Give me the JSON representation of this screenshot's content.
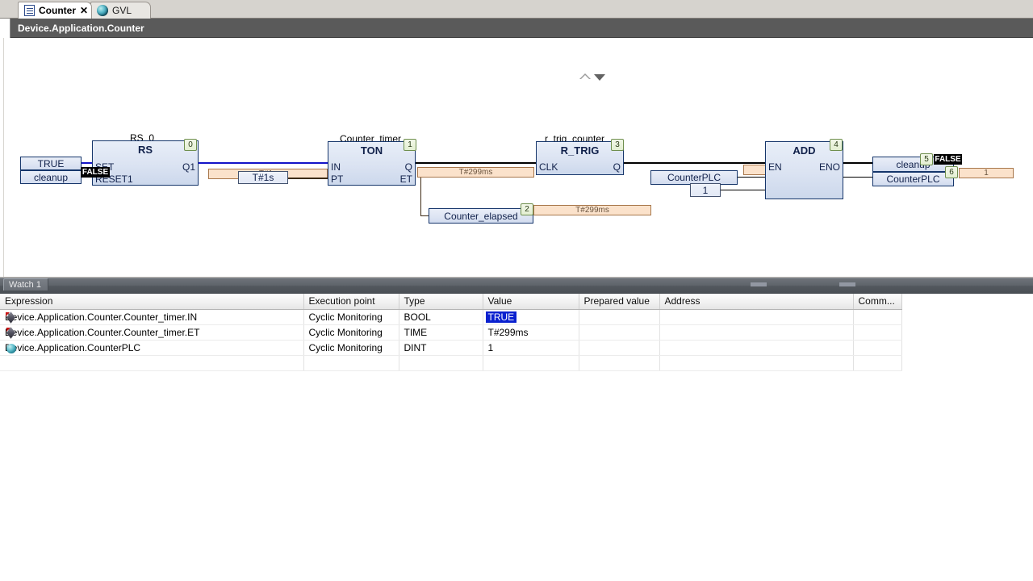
{
  "window": {
    "path_title": "Device.Application.Counter"
  },
  "tabs": [
    {
      "label": "Counter",
      "icon": "document-icon",
      "active": true,
      "close_label": "✕"
    },
    {
      "label": "GVL",
      "icon": "globe-icon",
      "active": false
    }
  ],
  "editor": {
    "nav_up": "scroll-up-arrow",
    "nav_down": "scroll-down-arrow",
    "blocks": [
      {
        "instance": "RS_0",
        "type": "RS",
        "badge": "0",
        "inputs": [
          "SET",
          "RESET1"
        ],
        "outputs": [
          "Q1"
        ]
      },
      {
        "instance": "Counter_timer",
        "type": "TON",
        "badge": "1",
        "inputs": [
          "IN",
          "PT"
        ],
        "outputs": [
          "Q",
          "ET"
        ]
      },
      {
        "instance": "r_trig_counter",
        "type": "R_TRIG",
        "badge": "3",
        "inputs": [
          "CLK"
        ],
        "outputs": [
          "Q"
        ]
      },
      {
        "instance": "",
        "type": "ADD",
        "badge": "4",
        "inputs": [
          "EN"
        ],
        "outputs": [
          "ENO"
        ]
      }
    ],
    "variables": {
      "rs_set_input": "TRUE",
      "rs_reset_input": "cleanup",
      "ton_pt_const": "T#1s",
      "counter_elapsed": "Counter_elapsed",
      "add_in_var": "CounterPLC",
      "add_in_const": "1",
      "out_cleanup": "cleanup",
      "out_counterplc": "CounterPLC"
    },
    "monitor_values": {
      "rs_reset_tooltip": "FALSE",
      "ton_pt_value": "T#1s",
      "ton_et_value": "T#299ms",
      "counter_elapsed_value": "T#299ms",
      "add_en_value": "1",
      "out_cleanup_value": "FALSE",
      "out_counterplc_value": "1"
    },
    "badges": {
      "counter_elapsed": "2",
      "out_cleanup": "5",
      "out_counterplc": "6"
    }
  },
  "watch": {
    "panel_title": "Watch 1",
    "columns": [
      "Expression",
      "Execution point",
      "Type",
      "Value",
      "Prepared value",
      "Address",
      "Comm..."
    ],
    "rows": [
      {
        "icon": "monitor-in-icon",
        "expression": "Device.Application.Counter.Counter_timer.IN",
        "execution_point": "Cyclic Monitoring",
        "type": "BOOL",
        "value": "TRUE",
        "value_selected": true,
        "prepared_value": "",
        "address": "",
        "comment": ""
      },
      {
        "icon": "monitor-out-icon",
        "expression": "Device.Application.Counter.Counter_timer.ET",
        "execution_point": "Cyclic Monitoring",
        "type": "TIME",
        "value": "T#299ms",
        "value_selected": false,
        "prepared_value": "",
        "address": "",
        "comment": ""
      },
      {
        "icon": "globe-icon",
        "expression": "Device.Application.CounterPLC",
        "execution_point": "Cyclic Monitoring",
        "type": "DINT",
        "value": "1",
        "value_selected": false,
        "prepared_value": "",
        "address": "",
        "comment": ""
      }
    ]
  },
  "colors": {
    "wire_true": "#1414c8",
    "wire_false": "#000000",
    "value_flag_bg": "#fbe2cb",
    "selection_blue": "#0a21cf",
    "header_bar": "#5a5a5a"
  }
}
